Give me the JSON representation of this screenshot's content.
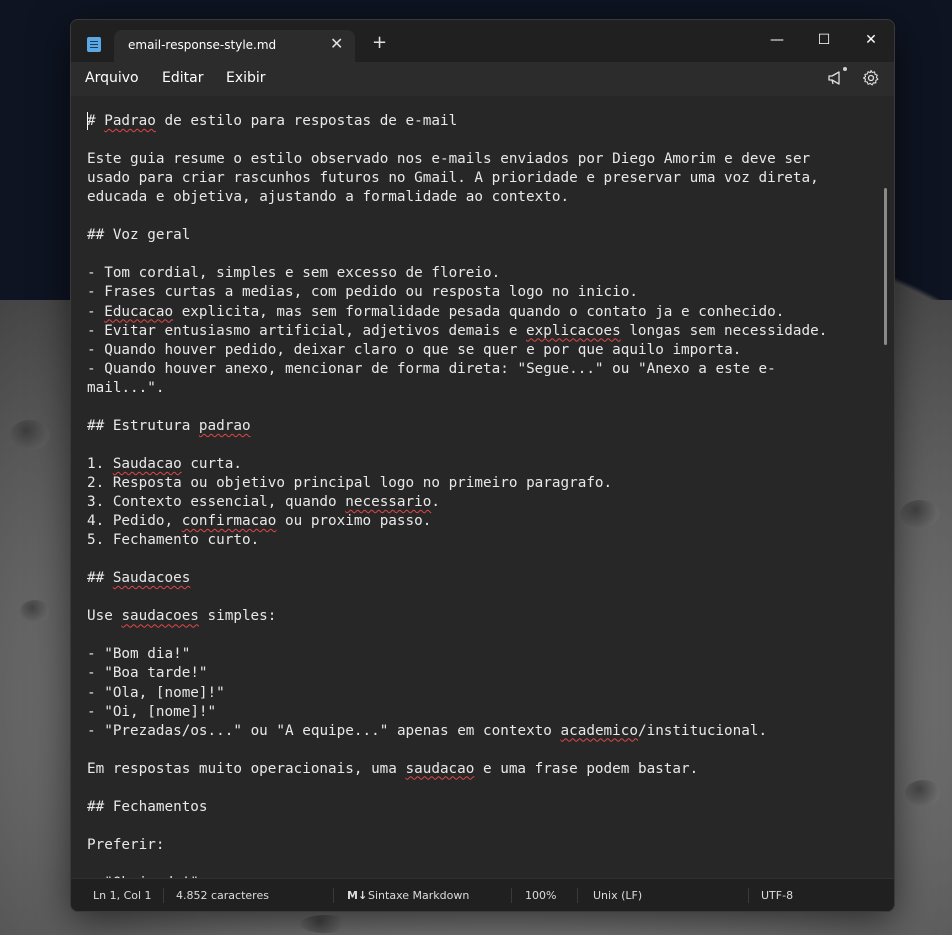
{
  "window": {
    "tab_title": "email-response-style.md",
    "tab_close": "✕",
    "new_tab": "+",
    "minimize": "—",
    "maximize": "☐",
    "close": "✕"
  },
  "menu": {
    "items": [
      "Arquivo",
      "Editar",
      "Exibir"
    ]
  },
  "editor": {
    "lines": [
      "# Padrao de estilo para respostas de e-mail",
      "",
      "Este guia resume o estilo observado nos e-mails enviados por Diego Amorim e deve ser",
      "usado para criar rascunhos futuros no Gmail. A prioridade e preservar uma voz direta,",
      "educada e objetiva, ajustando a formalidade ao contexto.",
      "",
      "## Voz geral",
      "",
      "- Tom cordial, simples e sem excesso de floreio.",
      "- Frases curtas a medias, com pedido ou resposta logo no inicio.",
      "- Educacao explicita, mas sem formalidade pesada quando o contato ja e conhecido.",
      "- Evitar entusiasmo artificial, adjetivos demais e explicacoes longas sem necessidade.",
      "- Quando houver pedido, deixar claro o que se quer e por que aquilo importa.",
      "- Quando houver anexo, mencionar de forma direta: \"Segue...\" ou \"Anexo a este e-",
      "mail...\".",
      "",
      "## Estrutura padrao",
      "",
      "1. Saudacao curta.",
      "2. Resposta ou objetivo principal logo no primeiro paragrafo.",
      "3. Contexto essencial, quando necessario.",
      "4. Pedido, confirmacao ou proximo passo.",
      "5. Fechamento curto.",
      "",
      "## Saudacoes",
      "",
      "Use saudacoes simples:",
      "",
      "- \"Bom dia!\"",
      "- \"Boa tarde!\"",
      "- \"Ola, [nome]!\"",
      "- \"Oi, [nome]!\"",
      "- \"Prezadas/os...\" ou \"A equipe...\" apenas em contexto academico/institucional.",
      "",
      "Em respostas muito operacionais, uma saudacao e uma frase podem bastar.",
      "",
      "## Fechamentos",
      "",
      "Preferir:",
      "",
      "- \"Obrigado!\""
    ]
  },
  "status": {
    "position": "Ln 1, Col 1",
    "chars": "4.852 caracteres",
    "syntax_icon": "M↓",
    "syntax": "Sintaxe Markdown",
    "zoom": "100%",
    "eol": "Unix (LF)",
    "encoding": "UTF-8"
  },
  "icons": {
    "app": "notepad-icon",
    "whats_new": "megaphone-icon",
    "settings": "gear-icon"
  },
  "colors": {
    "window_bg": "#272727",
    "titlebar_bg": "#202020",
    "text": "#e8e8e8",
    "spellcheck": "#e04747"
  }
}
